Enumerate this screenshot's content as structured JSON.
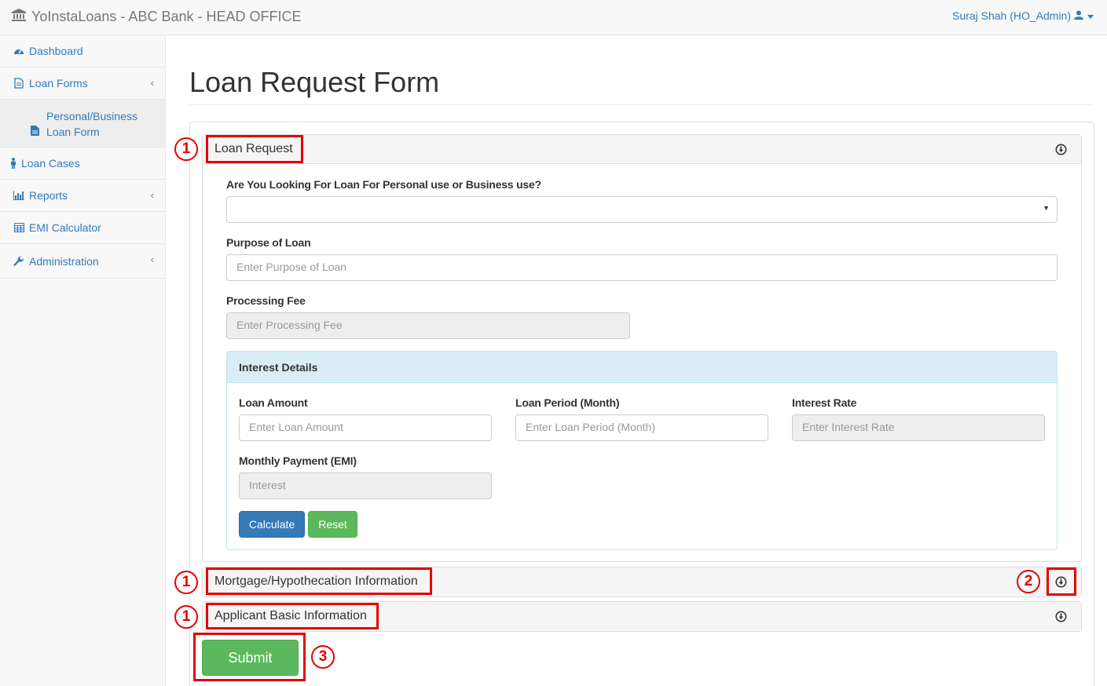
{
  "navbar": {
    "brand": "YoInstaLoans - ABC Bank - HEAD OFFICE",
    "user": "Suraj Shah (HO_Admin)"
  },
  "sidebar": {
    "items": [
      {
        "label": "Dashboard",
        "icon": "dashboard-icon"
      },
      {
        "label": "Loan Forms",
        "icon": "file-icon"
      },
      {
        "label": "Personal/Business Loan Form",
        "icon": "file-text-icon"
      },
      {
        "label": "Loan Cases",
        "icon": "person-icon"
      },
      {
        "label": "Reports",
        "icon": "bar-chart-icon"
      },
      {
        "label": "EMI Calculator",
        "icon": "calculator-icon"
      },
      {
        "label": "Administration",
        "icon": "wrench-icon"
      }
    ]
  },
  "page": {
    "title": "Loan Request Form"
  },
  "sections": {
    "loan_request": "Loan Request",
    "mortgage": "Mortgage/Hypothecation Information",
    "applicant": "Applicant Basic Information"
  },
  "form": {
    "use_type_label": "Are You Looking For Loan For Personal use or Business use?",
    "use_type_value": "",
    "purpose_label": "Purpose of Loan",
    "purpose_placeholder": "Enter Purpose of Loan",
    "fee_label": "Processing Fee",
    "fee_placeholder": "Enter Processing Fee"
  },
  "interest": {
    "heading": "Interest Details",
    "amount_label": "Loan Amount",
    "amount_placeholder": "Enter Loan Amount",
    "period_label": "Loan Period (Month)",
    "period_placeholder": "Enter Loan Period (Month)",
    "rate_label": "Interest Rate",
    "rate_placeholder": "Enter Interest Rate",
    "emi_label": "Monthly Payment (EMI)",
    "emi_placeholder": "Interest",
    "calculate": "Calculate",
    "reset": "Reset"
  },
  "submit": "Submit",
  "callouts": [
    "1",
    "1",
    "1",
    "2",
    "3"
  ],
  "colors": {
    "link": "#337ab7",
    "primary": "#337ab7",
    "success": "#5cb85c",
    "info_bg": "#d9edf7",
    "callout": "#e60000"
  }
}
